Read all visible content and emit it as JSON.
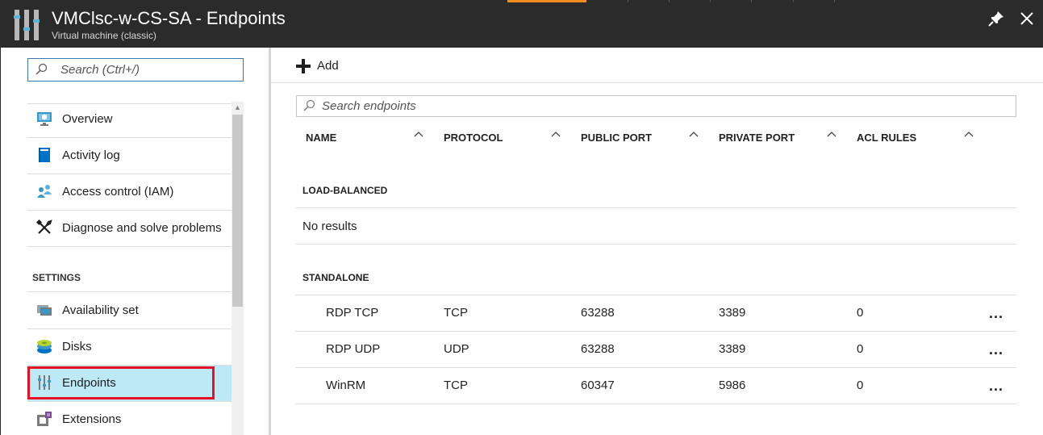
{
  "header": {
    "title": "VMClsc-w-CS-SA - Endpoints",
    "subtitle": "Virtual machine (classic)",
    "icon": "endpoints-icon",
    "pin_icon": "pin-icon",
    "close_icon": "close-icon"
  },
  "colors": {
    "header_bg": "#2b2b2b",
    "active_bg": "#bde8f5",
    "highlight_border": "#e81123",
    "accent": "#f08c1e"
  },
  "sidebar": {
    "search_placeholder": "Search (Ctrl+/)",
    "items": [
      {
        "label": "Overview",
        "icon": "overview-icon"
      },
      {
        "label": "Activity log",
        "icon": "activity-log-icon"
      },
      {
        "label": "Access control (IAM)",
        "icon": "iam-icon"
      },
      {
        "label": "Diagnose and solve problems",
        "icon": "wrench-icon"
      }
    ],
    "settings_label": "SETTINGS",
    "settings_items": [
      {
        "label": "Availability set",
        "icon": "availability-set-icon"
      },
      {
        "label": "Disks",
        "icon": "disks-icon"
      },
      {
        "label": "Endpoints",
        "icon": "endpoints-icon",
        "active": true
      },
      {
        "label": "Extensions",
        "icon": "extensions-icon"
      }
    ]
  },
  "toolbar": {
    "add_label": "Add"
  },
  "endpoints": {
    "search_placeholder": "Search endpoints",
    "columns": [
      "NAME",
      "PROTOCOL",
      "PUBLIC PORT",
      "PRIVATE PORT",
      "ACL RULES"
    ],
    "load_balanced_label": "LOAD-BALANCED",
    "load_balanced_empty": "No results",
    "standalone_label": "STANDALONE",
    "rows": [
      {
        "name": "RDP TCP",
        "protocol": "TCP",
        "public_port": "63288",
        "private_port": "3389",
        "acl_rules": "0",
        "more": "..."
      },
      {
        "name": "RDP UDP",
        "protocol": "UDP",
        "public_port": "63288",
        "private_port": "3389",
        "acl_rules": "0",
        "more": "..."
      },
      {
        "name": "WinRM",
        "protocol": "TCP",
        "public_port": "60347",
        "private_port": "5986",
        "acl_rules": "0",
        "more": "..."
      }
    ]
  }
}
